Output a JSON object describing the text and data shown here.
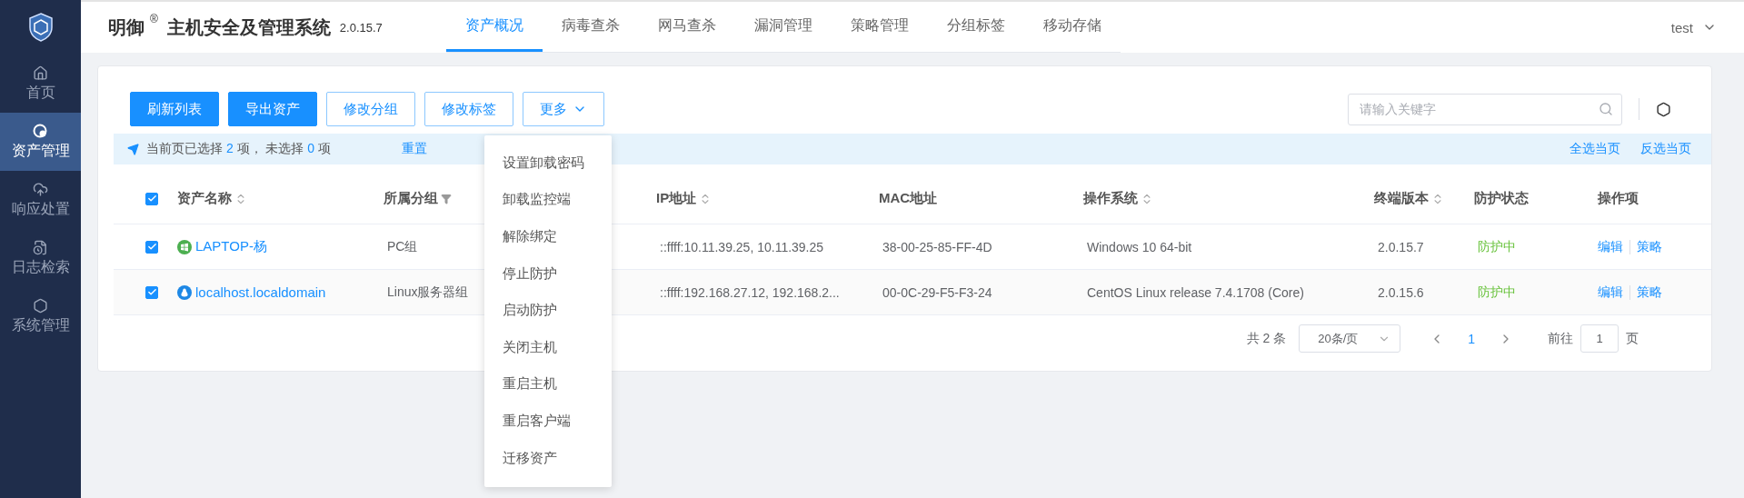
{
  "sidebar": {
    "items": [
      {
        "label": "首页",
        "selected": false
      },
      {
        "label": "资产管理",
        "selected": true
      },
      {
        "label": "响应处置",
        "selected": false
      },
      {
        "label": "日志检索",
        "selected": false
      },
      {
        "label": "系统管理",
        "selected": false
      }
    ]
  },
  "header": {
    "brand": "明御",
    "registered": "®",
    "product": "主机安全及管理系统",
    "version": "2.0.15.7",
    "user": "test",
    "tabs": [
      {
        "label": "资产概况",
        "selected": true
      },
      {
        "label": "病毒查杀",
        "selected": false
      },
      {
        "label": "网马查杀",
        "selected": false
      },
      {
        "label": "漏洞管理",
        "selected": false
      },
      {
        "label": "策略管理",
        "selected": false
      },
      {
        "label": "分组标签",
        "selected": false
      },
      {
        "label": "移动存储",
        "selected": false
      }
    ]
  },
  "toolbar": {
    "buttons": [
      {
        "label": "刷新列表",
        "kind": "primary"
      },
      {
        "label": "导出资产",
        "kind": "primary"
      },
      {
        "label": "修改分组",
        "kind": "outline"
      },
      {
        "label": "修改标签",
        "kind": "outline"
      },
      {
        "label": "更多",
        "kind": "dropdown"
      }
    ],
    "search": {
      "placeholder": "请输入关键字"
    }
  },
  "more_menu": {
    "items": [
      "设置卸载密码",
      "卸载监控端",
      "解除绑定",
      "停止防护",
      "启动防护",
      "关闭主机",
      "重启主机",
      "重启客户端",
      "迁移资产"
    ]
  },
  "selection_bar": {
    "prefix": "当前页已选择",
    "selected_count": "2",
    "middle": "项， 未选择",
    "unselected_count": "0",
    "suffix": "项",
    "reset": "重置",
    "select_page": "全选当页",
    "invert_page": "反选当页"
  },
  "table": {
    "all_checked": true,
    "columns": [
      {
        "label": "资产名称",
        "sortable": true,
        "filterable": false
      },
      {
        "label": "所属分组",
        "sortable": false,
        "filterable": true
      },
      {
        "label": "IP地址",
        "sortable": true,
        "filterable": false
      },
      {
        "label": "MAC地址",
        "sortable": false,
        "filterable": false
      },
      {
        "label": "操作系统",
        "sortable": true,
        "filterable": false
      },
      {
        "label": "终端版本",
        "sortable": true,
        "filterable": false
      },
      {
        "label": "防护状态",
        "sortable": false,
        "filterable": false
      },
      {
        "label": "操作项",
        "sortable": false,
        "filterable": false
      }
    ],
    "rows": [
      {
        "checked": true,
        "kind": "windows",
        "name": "LAPTOP-杨",
        "group": "PC组",
        "ip": "::ffff:10.11.39.25, 10.11.39.25",
        "mac": "38-00-25-85-FF-4D",
        "os": "Windows 10 64-bit",
        "version": "2.0.15.7",
        "status": "防护中",
        "actions": [
          "编辑",
          "策略"
        ]
      },
      {
        "checked": true,
        "kind": "linux",
        "name": "localhost.localdomain",
        "group": "Linux服务器组",
        "ip": "::ffff:192.168.27.12, 192.168.2...",
        "mac": "00-0C-29-F5-F3-24",
        "os": "CentOS Linux release 7.4.1708 (Core)",
        "version": "2.0.15.6",
        "status": "防护中",
        "actions": [
          "编辑",
          "策略"
        ]
      }
    ]
  },
  "pagination": {
    "total": "共 2 条",
    "page_size": "20条/页",
    "pages": [
      {
        "label": "1",
        "selected": true
      }
    ],
    "goto_label": "前往",
    "goto_value": "1",
    "goto_suffix": "页"
  }
}
